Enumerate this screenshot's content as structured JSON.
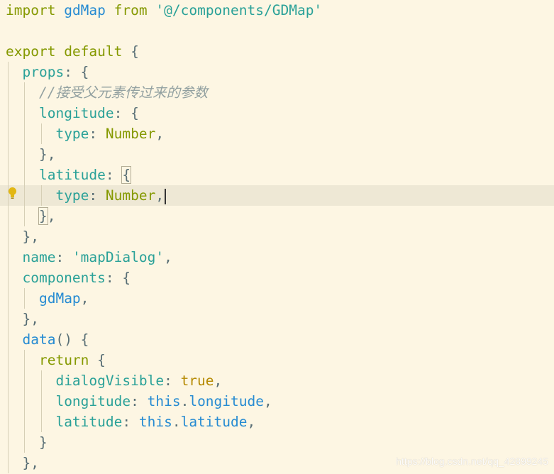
{
  "editor": {
    "lines": [
      {
        "tokens": [
          {
            "t": "import",
            "c": "kw"
          },
          {
            "t": " ",
            "c": "pun"
          },
          {
            "t": "gdMap",
            "c": "fn"
          },
          {
            "t": " ",
            "c": "pun"
          },
          {
            "t": "from",
            "c": "kw"
          },
          {
            "t": " ",
            "c": "pun"
          },
          {
            "t": "'@/components/GDMap'",
            "c": "str"
          }
        ]
      },
      {
        "tokens": []
      },
      {
        "tokens": [
          {
            "t": "export",
            "c": "kw"
          },
          {
            "t": " ",
            "c": "pun"
          },
          {
            "t": "default",
            "c": "kw"
          },
          {
            "t": " {",
            "c": "pun"
          }
        ]
      },
      {
        "tokens": [
          {
            "t": "  ",
            "c": "pun"
          },
          {
            "t": "props",
            "c": "prop"
          },
          {
            "t": ": {",
            "c": "pun"
          }
        ]
      },
      {
        "tokens": [
          {
            "t": "    ",
            "c": "pun"
          },
          {
            "t": "//接受父元素传过来的参数",
            "c": "cmt"
          }
        ]
      },
      {
        "tokens": [
          {
            "t": "    ",
            "c": "pun"
          },
          {
            "t": "longitude",
            "c": "prop"
          },
          {
            "t": ": {",
            "c": "pun"
          }
        ]
      },
      {
        "tokens": [
          {
            "t": "      ",
            "c": "pun"
          },
          {
            "t": "type",
            "c": "prop"
          },
          {
            "t": ": ",
            "c": "pun"
          },
          {
            "t": "Number",
            "c": "type"
          },
          {
            "t": ",",
            "c": "pun"
          }
        ]
      },
      {
        "tokens": [
          {
            "t": "    },",
            "c": "pun"
          }
        ]
      },
      {
        "tokens": [
          {
            "t": "    ",
            "c": "pun"
          },
          {
            "t": "latitude",
            "c": "prop"
          },
          {
            "t": ": ",
            "c": "pun"
          },
          {
            "t": "{",
            "c": "pun",
            "hl": true
          }
        ]
      },
      {
        "current": true,
        "bulb": true,
        "cursor": true,
        "tokens": [
          {
            "t": "      ",
            "c": "pun"
          },
          {
            "t": "type",
            "c": "prop"
          },
          {
            "t": ": ",
            "c": "pun"
          },
          {
            "t": "Number",
            "c": "type"
          },
          {
            "t": ",",
            "c": "pun"
          }
        ]
      },
      {
        "tokens": [
          {
            "t": "    ",
            "c": "pun"
          },
          {
            "t": "}",
            "c": "pun",
            "hl": true
          },
          {
            "t": ",",
            "c": "pun"
          }
        ]
      },
      {
        "tokens": [
          {
            "t": "  },",
            "c": "pun"
          }
        ]
      },
      {
        "tokens": [
          {
            "t": "  ",
            "c": "pun"
          },
          {
            "t": "name",
            "c": "prop"
          },
          {
            "t": ": ",
            "c": "pun"
          },
          {
            "t": "'mapDialog'",
            "c": "str"
          },
          {
            "t": ",",
            "c": "pun"
          }
        ]
      },
      {
        "tokens": [
          {
            "t": "  ",
            "c": "pun"
          },
          {
            "t": "components",
            "c": "prop"
          },
          {
            "t": ": {",
            "c": "pun"
          }
        ]
      },
      {
        "tokens": [
          {
            "t": "    ",
            "c": "pun"
          },
          {
            "t": "gdMap",
            "c": "fn"
          },
          {
            "t": ",",
            "c": "pun"
          }
        ]
      },
      {
        "tokens": [
          {
            "t": "  },",
            "c": "pun"
          }
        ]
      },
      {
        "tokens": [
          {
            "t": "  ",
            "c": "pun"
          },
          {
            "t": "data",
            "c": "fn"
          },
          {
            "t": "() {",
            "c": "pun"
          }
        ]
      },
      {
        "tokens": [
          {
            "t": "    ",
            "c": "pun"
          },
          {
            "t": "return",
            "c": "kw"
          },
          {
            "t": " {",
            "c": "pun"
          }
        ]
      },
      {
        "tokens": [
          {
            "t": "      ",
            "c": "pun"
          },
          {
            "t": "dialogVisible",
            "c": "prop"
          },
          {
            "t": ": ",
            "c": "pun"
          },
          {
            "t": "true",
            "c": "bool"
          },
          {
            "t": ",",
            "c": "pun"
          }
        ]
      },
      {
        "tokens": [
          {
            "t": "      ",
            "c": "pun"
          },
          {
            "t": "longitude",
            "c": "prop"
          },
          {
            "t": ": ",
            "c": "pun"
          },
          {
            "t": "this",
            "c": "this"
          },
          {
            "t": ".",
            "c": "pun"
          },
          {
            "t": "longitude",
            "c": "fn"
          },
          {
            "t": ",",
            "c": "pun"
          }
        ]
      },
      {
        "tokens": [
          {
            "t": "      ",
            "c": "pun"
          },
          {
            "t": "latitude",
            "c": "prop"
          },
          {
            "t": ": ",
            "c": "pun"
          },
          {
            "t": "this",
            "c": "this"
          },
          {
            "t": ".",
            "c": "pun"
          },
          {
            "t": "latitude",
            "c": "fn"
          },
          {
            "t": ",",
            "c": "pun"
          }
        ]
      },
      {
        "tokens": [
          {
            "t": "    }",
            "c": "pun"
          }
        ]
      },
      {
        "tokens": [
          {
            "t": "  },",
            "c": "pun"
          }
        ]
      }
    ]
  },
  "icons": {
    "bulb": "lightbulb-icon"
  },
  "colors": {
    "background": "#fdf6e3",
    "current_line": "#eee8d5",
    "keyword": "#859900",
    "function": "#268bd2",
    "property": "#2aa198",
    "string": "#2aa198",
    "boolean": "#b58900",
    "comment": "#93a1a1"
  },
  "watermark": "https://blog.csdn.net/qq_42899245"
}
